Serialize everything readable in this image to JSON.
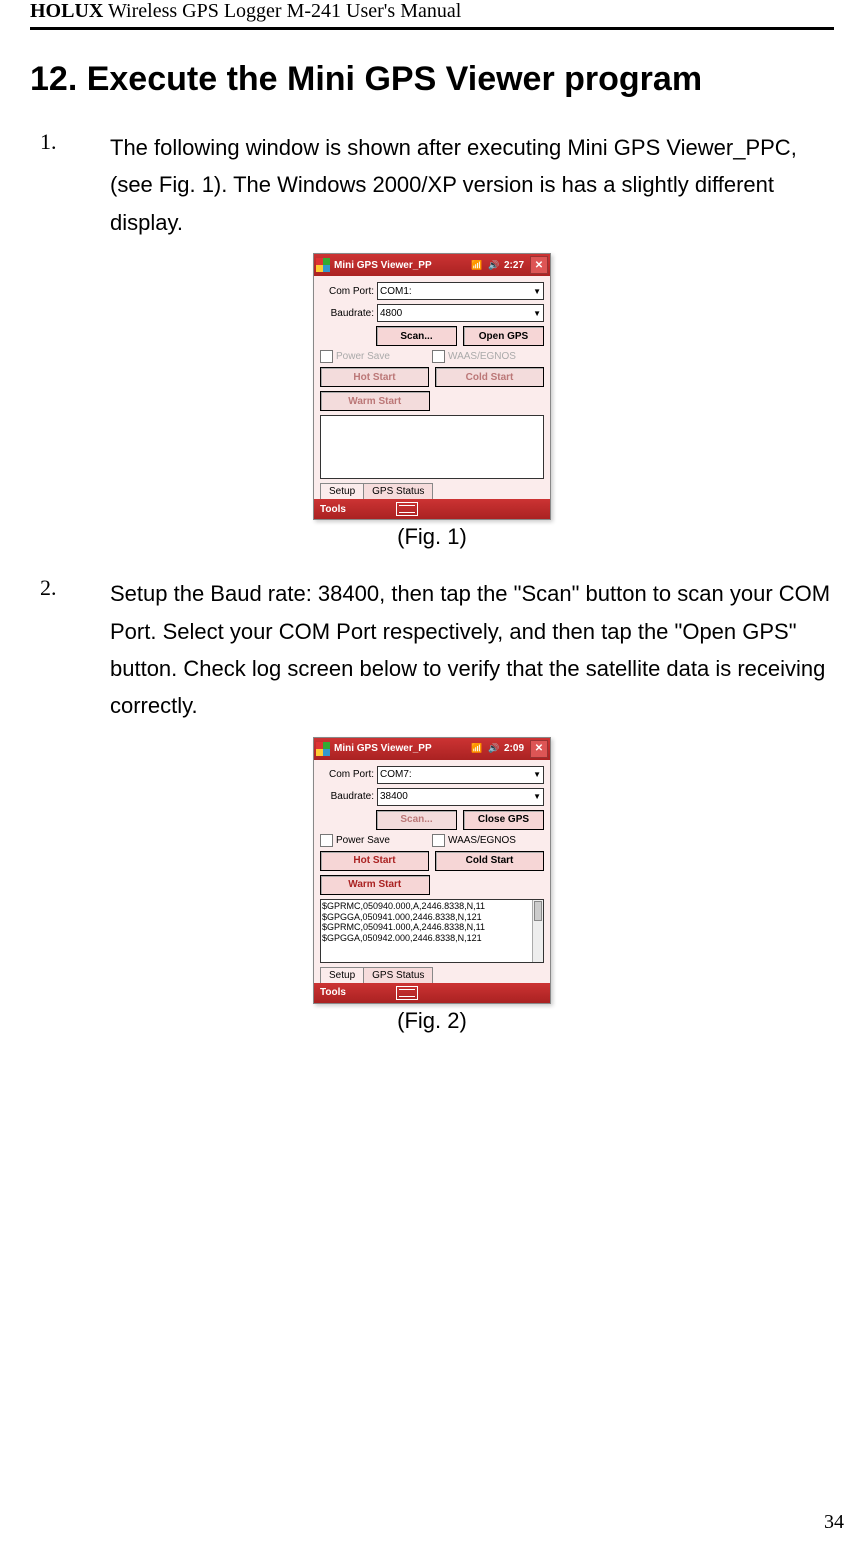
{
  "header": {
    "brand_bold": "HOLUX",
    "brand_rest": " Wireless GPS Logger M-241 User's Manual"
  },
  "section": {
    "title": "12. Execute the Mini GPS Viewer program"
  },
  "items": [
    {
      "num": "1.",
      "text": "The following window is shown after executing Mini GPS Viewer_PPC, (see Fig. 1). The Windows 2000/XP version is has a slightly different display."
    },
    {
      "num": "2.",
      "text": "Setup the Baud rate: 38400, then tap the \"Scan\" button to scan your COM Port. Select your COM Port respectively, and then tap the \"Open GPS\" button. Check log screen below to verify that the satellite data is receiving correctly."
    }
  ],
  "captions": {
    "fig1": "(Fig. 1)",
    "fig2": "(Fig. 2)"
  },
  "page_number": "34",
  "fig1": {
    "title": "Mini GPS Viewer_PP",
    "time": "2:27",
    "com_label": "Com Port:",
    "com_value": "COM1:",
    "baud_label": "Baudrate:",
    "baud_value": "4800",
    "scan": "Scan...",
    "open": "Open GPS",
    "powersave": "Power Save",
    "waas": "WAAS/EGNOS",
    "hot": "Hot Start",
    "cold": "Cold Start",
    "warm": "Warm Start",
    "tab_setup": "Setup",
    "tab_status": "GPS Status",
    "tools": "Tools"
  },
  "fig2": {
    "title": "Mini GPS Viewer_PP",
    "time": "2:09",
    "com_label": "Com Port:",
    "com_value": "COM7:",
    "baud_label": "Baudrate:",
    "baud_value": "38400",
    "scan": "Scan...",
    "close": "Close GPS",
    "powersave": "Power Save",
    "waas": "WAAS/EGNOS",
    "hot": "Hot Start",
    "cold": "Cold Start",
    "warm": "Warm Start",
    "log": [
      "$GPRMC,050940.000,A,2446.8338,N,11",
      "$GPGGA,050941.000,2446.8338,N,121",
      "$GPRMC,050941.000,A,2446.8338,N,11",
      "$GPGGA,050942.000,2446.8338,N,121"
    ],
    "tab_setup": "Setup",
    "tab_status": "GPS Status",
    "tools": "Tools"
  }
}
